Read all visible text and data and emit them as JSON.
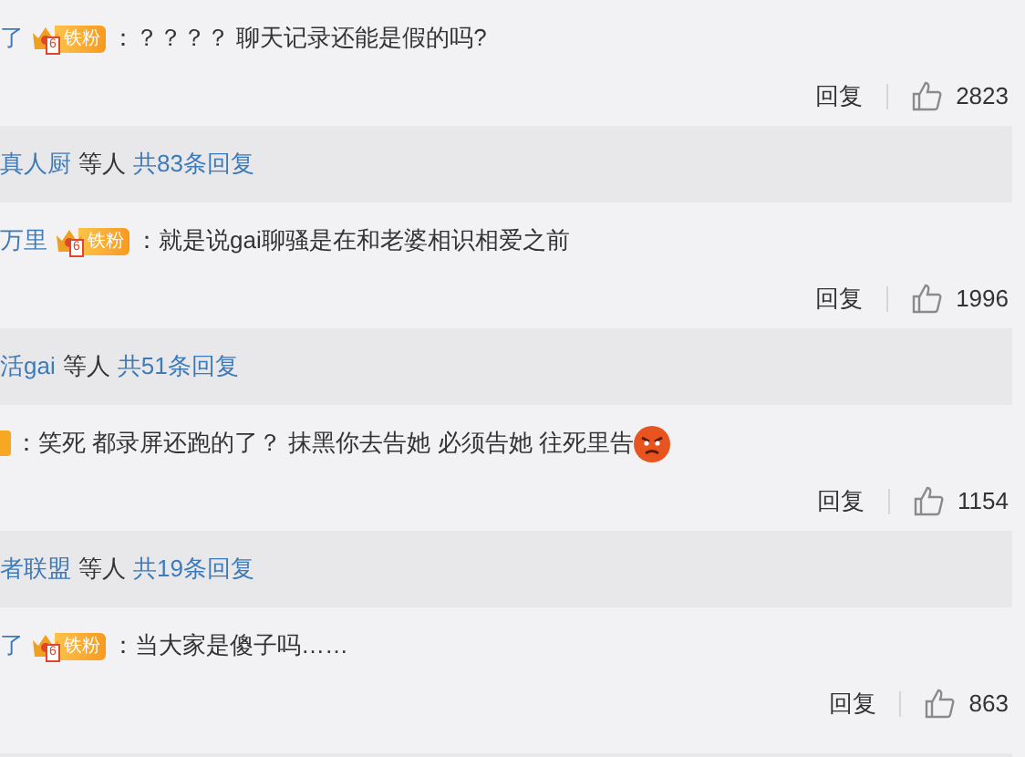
{
  "comments": [
    {
      "user": "了",
      "badge": {
        "kind": "full",
        "level": "6",
        "label": "铁粉"
      },
      "text": "：？？？？ 聊天记录还能是假的吗?",
      "has_emoji": false,
      "reply_label": "回复",
      "likes": "2823",
      "replies": {
        "users": "真人厨",
        "middle": "等人",
        "total": "共83条回复"
      }
    },
    {
      "user": "万里",
      "badge": {
        "kind": "full",
        "level": "6",
        "label": "铁粉"
      },
      "text": "：就是说gai聊骚是在和老婆相识相爱之前",
      "has_emoji": false,
      "reply_label": "回复",
      "likes": "1996",
      "replies": {
        "users": "活gai",
        "middle": "等人",
        "total": "共51条回复"
      }
    },
    {
      "badge": {
        "kind": "cut"
      },
      "text": "：笑死 都录屏还跑的了？ 抹黑你去告她 必须告她 往死里告",
      "has_emoji": true,
      "reply_label": "回复",
      "likes": "1154",
      "replies": {
        "users": "者联盟",
        "middle": "等人",
        "total": "共19条回复"
      }
    },
    {
      "user": "了",
      "badge": {
        "kind": "full",
        "level": "6",
        "label": "铁粉"
      },
      "text": "：当大家是傻子吗……",
      "has_emoji": false,
      "reply_label": "回复",
      "likes": "863",
      "replies": {
        "kind": "empty"
      }
    }
  ]
}
